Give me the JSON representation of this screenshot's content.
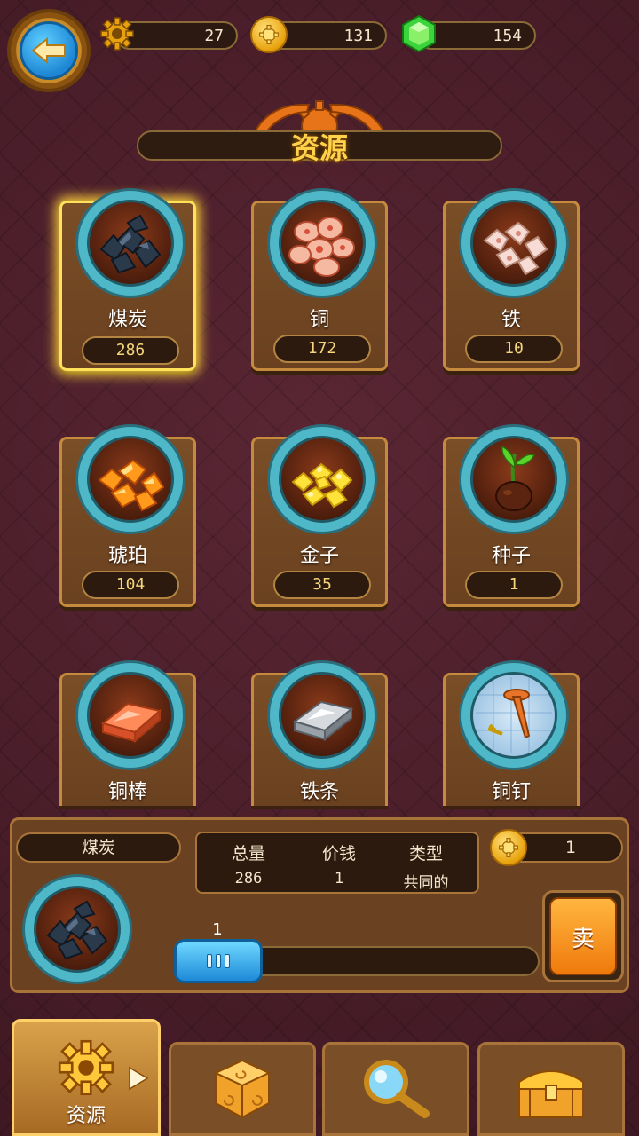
{
  "top_bar": {
    "gears": "27",
    "coins": "131",
    "gems": "154"
  },
  "title": "资源",
  "resources": [
    {
      "name": "煤炭",
      "count": "286",
      "icon": "coal-icon",
      "selected": true
    },
    {
      "name": "铜",
      "count": "172",
      "icon": "copper-ore-icon"
    },
    {
      "name": "铁",
      "count": "10",
      "icon": "iron-ore-icon"
    },
    {
      "name": "琥珀",
      "count": "104",
      "icon": "amber-icon"
    },
    {
      "name": "金子",
      "count": "35",
      "icon": "gold-nugget-icon"
    },
    {
      "name": "种子",
      "count": "1",
      "icon": "seed-sprout-icon"
    },
    {
      "name": "铜棒",
      "icon": "copper-bar-icon"
    },
    {
      "name": "铁条",
      "icon": "iron-bar-icon"
    },
    {
      "name": "铜钉",
      "icon": "copper-nail-icon"
    }
  ],
  "detail": {
    "name": "煤炭",
    "headers": {
      "total": "总量",
      "price": "价钱",
      "type": "类型"
    },
    "values": {
      "total": "286",
      "price": "1",
      "type": "共同的"
    },
    "coin_amount": "1",
    "slider_value": "1",
    "sell_label": "卖"
  },
  "tabs": {
    "active_label": "资源"
  },
  "colors": {
    "background": "#4a1f2a",
    "card": "#7a4e26",
    "accent_gold": "#ffd24a",
    "teal_ring": "#4fb8c8",
    "slider_blue": "#1e8ad8"
  }
}
